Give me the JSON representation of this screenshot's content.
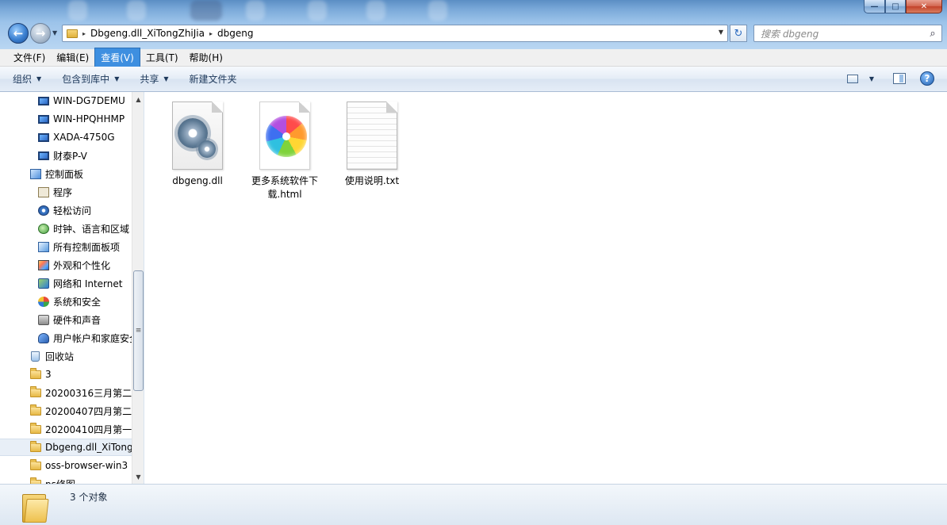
{
  "window": {
    "minimize_glyph": "—",
    "maximize_glyph": "□",
    "close_glyph": "✕"
  },
  "address": {
    "segments": [
      "Dbgeng.dll_XiTongZhiJia",
      "dbgeng"
    ],
    "separator": "▸"
  },
  "search": {
    "placeholder": "搜索 dbgeng"
  },
  "menu": {
    "items": [
      {
        "label": "文件(F)"
      },
      {
        "label": "编辑(E)"
      },
      {
        "label": "查看(V)"
      },
      {
        "label": "工具(T)"
      },
      {
        "label": "帮助(H)"
      }
    ]
  },
  "toolbar": {
    "organize": "组织",
    "include_library": "包含到库中",
    "share": "共享",
    "new_folder": "新建文件夹"
  },
  "nav": {
    "items": [
      {
        "label": "WIN-DG7DEMU",
        "icon": "monitor-icon"
      },
      {
        "label": "WIN-HPQHHMP",
        "icon": "monitor-icon"
      },
      {
        "label": "XADA-4750G",
        "icon": "monitor-icon"
      },
      {
        "label": "财泰P-V",
        "icon": "monitor-icon"
      },
      {
        "label": "控制面板",
        "icon": "control-panel-icon"
      },
      {
        "label": "程序",
        "icon": "programs-icon"
      },
      {
        "label": "轻松访问",
        "icon": "ease-of-access-icon"
      },
      {
        "label": "时钟、语言和区域",
        "icon": "clock-region-icon"
      },
      {
        "label": "所有控制面板项",
        "icon": "all-control-panel-icon"
      },
      {
        "label": "外观和个性化",
        "icon": "appearance-icon"
      },
      {
        "label": "网络和 Internet",
        "icon": "network-icon"
      },
      {
        "label": "系统和安全",
        "icon": "system-security-icon"
      },
      {
        "label": "硬件和声音",
        "icon": "hardware-sound-icon"
      },
      {
        "label": "用户帐户和家庭安全",
        "icon": "user-accounts-icon"
      },
      {
        "label": "回收站",
        "icon": "recycle-bin-icon"
      },
      {
        "label": "3",
        "icon": "folder-icon"
      },
      {
        "label": "20200316三月第二",
        "icon": "folder-icon"
      },
      {
        "label": "20200407四月第二",
        "icon": "folder-icon"
      },
      {
        "label": "20200410四月第一",
        "icon": "folder-icon"
      },
      {
        "label": "Dbgeng.dll_XiTongZhiJia",
        "icon": "folder-icon"
      },
      {
        "label": "oss-browser-win3",
        "icon": "folder-icon"
      },
      {
        "label": "ps修图",
        "icon": "folder-icon"
      }
    ],
    "scroll_glyph_up": "▲",
    "scroll_glyph_down": "▼",
    "scroll_grip": "≡"
  },
  "files": [
    {
      "name": "dbgeng.dll",
      "icon": "dll-gear-icon"
    },
    {
      "name": "更多系统软件下载.html",
      "icon": "browser-html-icon"
    },
    {
      "name": "使用说明.txt",
      "icon": "text-file-icon"
    }
  ],
  "status": {
    "count_text": "3 个对象"
  }
}
